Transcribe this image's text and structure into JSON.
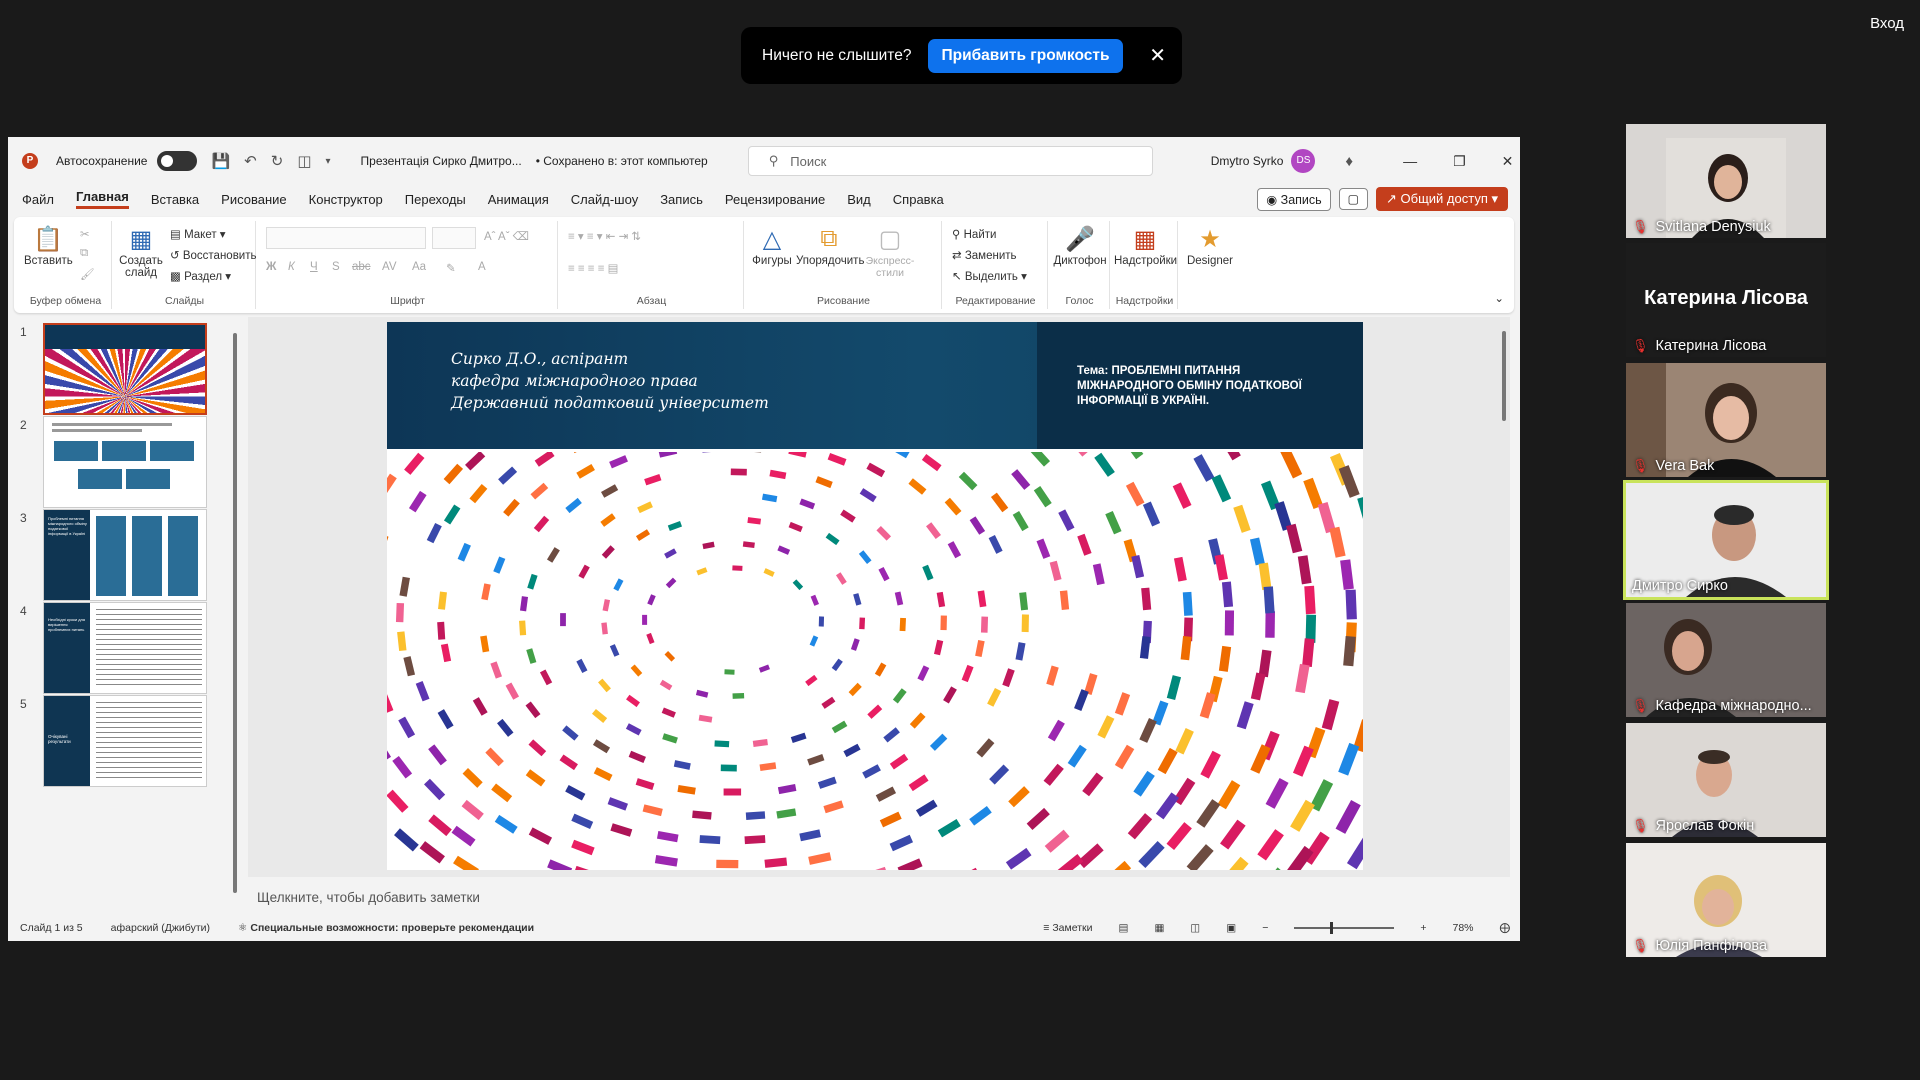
{
  "banner": {
    "message": "Ничего не слышите?",
    "button": "Прибавить громкость",
    "close": "✕"
  },
  "signin": "Вход",
  "ppt": {
    "autosave_label": "Автосохранение",
    "doc_title": "Презентація Сирко Дмитро...",
    "saved_state": "• Сохранено в: этот компьютер",
    "search_placeholder": "Поиск",
    "user_name": "Dmytro Syrko",
    "user_initials": "DS",
    "menu": [
      "Файл",
      "Главная",
      "Вставка",
      "Рисование",
      "Конструктор",
      "Переходы",
      "Анимация",
      "Слайд-шоу",
      "Запись",
      "Рецензирование",
      "Вид",
      "Справка"
    ],
    "record_button": "Запись",
    "share_button": "Общий доступ",
    "ribbon": {
      "paste": "Вставить",
      "clipboard_group": "Буфер обмена",
      "new_slide": "Создать слайд",
      "layout": "Макет",
      "reset": "Восстановить",
      "section": "Раздел",
      "slides_group": "Слайды",
      "font_group": "Шрифт",
      "paragraph_group": "Абзац",
      "shapes": "Фигуры",
      "arrange": "Упорядочить",
      "quick_styles": "Экспресс-стили",
      "drawing_group": "Рисование",
      "find": "Найти",
      "replace": "Заменить",
      "select": "Выделить",
      "editing_group": "Редактирование",
      "dictate": "Диктофон",
      "voice_group": "Голос",
      "addins": "Надстройки",
      "addins_group": "Надстройки",
      "designer": "Designer"
    },
    "slides": [
      "1",
      "2",
      "3",
      "4",
      "5"
    ],
    "slide": {
      "author_line1": "Сирко Д.О., аспірант",
      "author_line2": "кафедра міжнародного права",
      "author_line3": "Державний податковий університет",
      "topic_prefix": "Тема: ",
      "topic_text": "ПРОБЛЕМНІ ПИТАННЯ МІЖНАРОДНОГО ОБМІНУ ПОДАТКОВОЇ ІНФОРМАЦІЇ В УКРАЇНІ."
    },
    "notes_placeholder": "Щелкните, чтобы добавить заметки",
    "status": {
      "slide_count": "Слайд 1 из 5",
      "language": "афарский (Джибути)",
      "accessibility": "Специальные возможности: проверьте рекомендации",
      "notes": "Заметки",
      "zoom": "78%"
    },
    "thumb_texts": {
      "t3": "Проблемні питання міжнародного обміну податкової інформації в Україні",
      "t4": "Необхідні кроки для вирішення проблемних питань",
      "t5": "Очікувані результати"
    }
  },
  "participants": [
    {
      "name": "Svitlana Denysiuk",
      "muted": true
    },
    {
      "name": "Катерина Лісова",
      "muted": true,
      "no_video": true
    },
    {
      "name": "Vera Bak",
      "muted": true
    },
    {
      "name": "Дмитро Сирко",
      "muted": false,
      "active": true
    },
    {
      "name": "Кафедра міжнародно...",
      "muted": true
    },
    {
      "name": "Ярослав Фокін",
      "muted": true
    },
    {
      "name": "Юлія Панфілова",
      "muted": true
    }
  ],
  "colors": {
    "ppt_accent": "#c43e1c",
    "zoom_blue": "#0e72ed",
    "active_speaker": "#c9e35b",
    "slide_navy": "#0d3656"
  }
}
